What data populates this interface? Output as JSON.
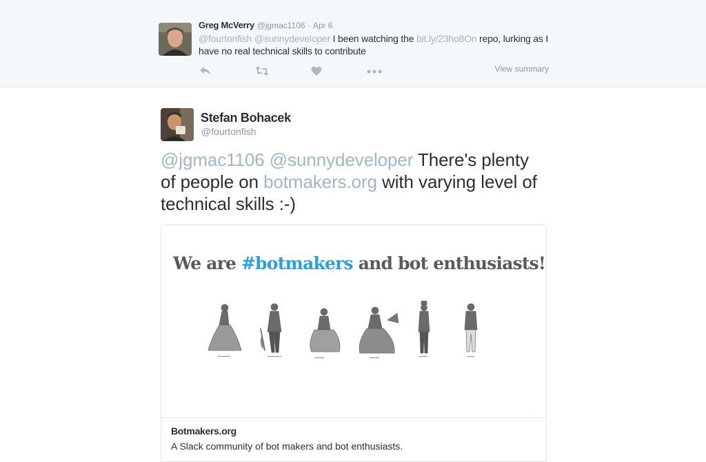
{
  "parent_tweet": {
    "name": "Greg McVerry",
    "handle": "@jgmac1106",
    "dot": "·",
    "date": "Apr 6",
    "mention1": "@fourtonfish",
    "mention2": "@sunnydeveloper",
    "text1": "I  been watching the",
    "link": "bit.ly/23ho8On",
    "text2": "repo, lurking as I have no real technical skills to contribute",
    "view_summary": "View summary",
    "actions": [
      "reply-icon",
      "retweet-icon",
      "like-icon",
      "more-icon"
    ]
  },
  "tweet": {
    "name": "Stefan Bohacek",
    "handle": "@fourtonfish",
    "mention1": "@jgmac1106",
    "mention2": "@sunnydeveloper",
    "text1": "There's plenty of people on",
    "link": "botmakers.org",
    "text2": "with varying level of technical skills :-)"
  },
  "card": {
    "heading_pre": "We are",
    "heading_hash": "#botmakers",
    "heading_post": "and bot enthusiasts!",
    "title": "Botmakers.org",
    "description": "A Slack community of bot makers and bot enthusiasts."
  },
  "colors": {
    "link": "#9eb6c8",
    "hashtag": "#2a9fdc",
    "parent_bg": "#f5f8fa"
  }
}
